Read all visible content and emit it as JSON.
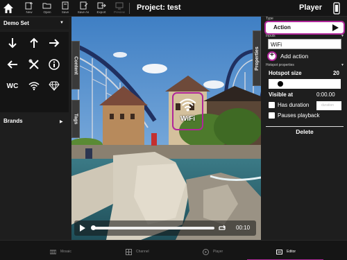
{
  "toolbar": {
    "new_label": "New",
    "open_label": "Open",
    "save_label": "Save",
    "save_as_label": "Save As",
    "export_label": "Export",
    "preview_label": "Preview",
    "project_title": "Project: test",
    "mode_label": "Player"
  },
  "left_panel": {
    "set_title": "Demo Set",
    "set_arrow": "▼",
    "icons": [
      "arrow-down-icon",
      "arrow-up-icon",
      "arrow-right-icon",
      "arrow-left-icon",
      "tools-icon",
      "info-icon",
      "wc-icon",
      "wifi-icon",
      "diamond-icon"
    ],
    "wc_text": "WC",
    "brands_title": "Brands",
    "brands_arrow": "▶"
  },
  "viewport": {
    "content_tab": "Content",
    "tags_tab": "Tags",
    "properties_tab": "Properties",
    "hotspot_label": "WiFi",
    "time": "00:10"
  },
  "properties": {
    "type_label": "Type",
    "type_value": "Action",
    "inputs_label": "Inputs",
    "input_value": "WiFi",
    "add_action_label": "Add action",
    "hotspot_props_label": "Hotspot properties",
    "hotspot_size_label": "Hotspot size",
    "hotspot_size_value": "20",
    "visible_at_label": "Visible at",
    "visible_at_value": "0:00.00",
    "has_duration_label": "Has duration",
    "duration_placeholder": "duration",
    "pauses_playback_label": "Pauses playback",
    "delete_label": "Delete"
  },
  "bottom_nav": {
    "mosaic_label": "Mosaic",
    "channel_label": "Channel",
    "player_label": "Player",
    "editor_label": "Editor"
  },
  "colors": {
    "accent": "#b0269a",
    "background": "#1e1e1e",
    "toolbar": "#151515"
  }
}
